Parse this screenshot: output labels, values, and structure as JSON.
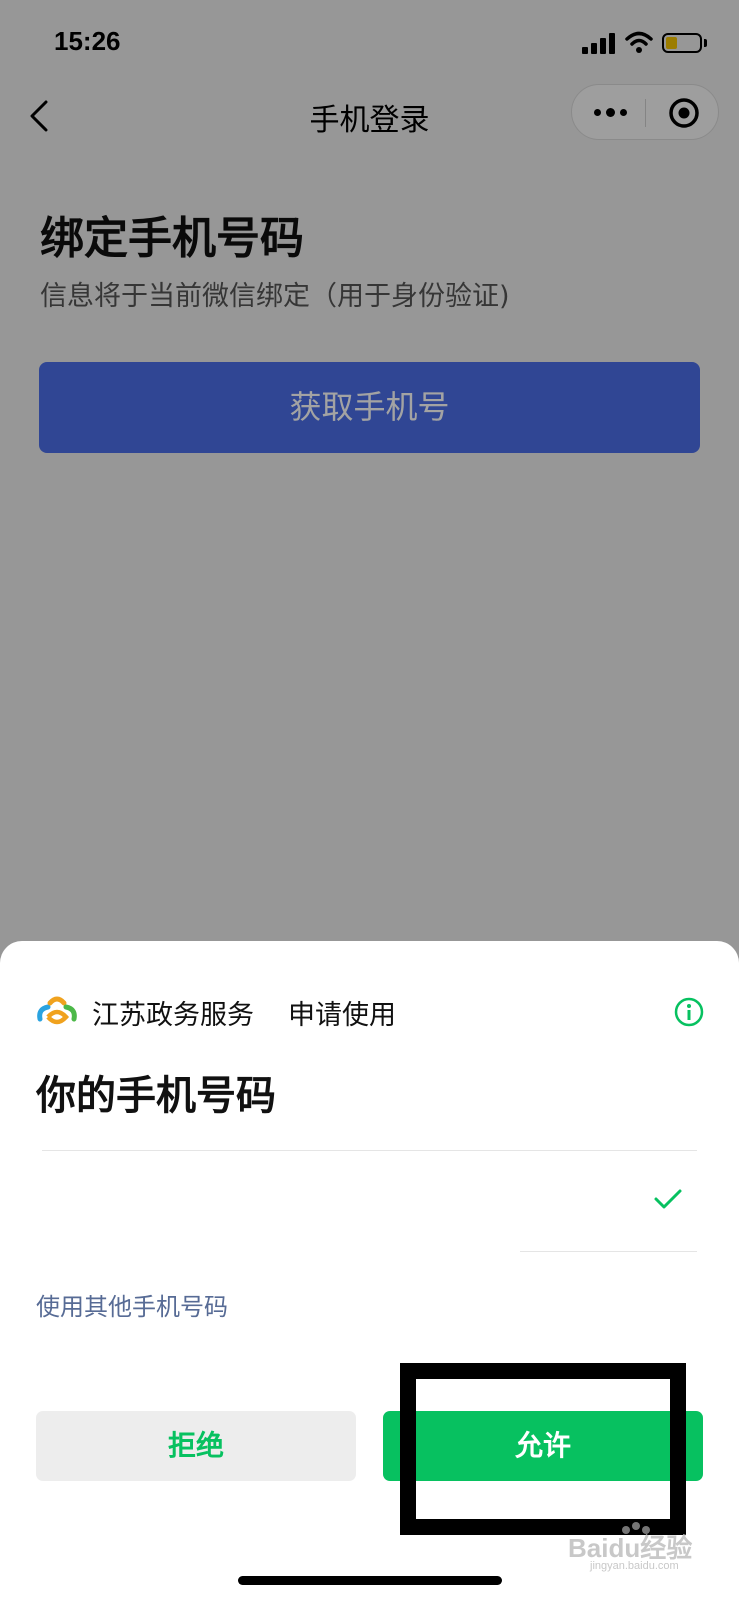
{
  "status_bar": {
    "time": "15:26"
  },
  "nav": {
    "title": "手机登录"
  },
  "page": {
    "heading": "绑定手机号码",
    "subtitle": "信息将于当前微信绑定（用于身份验证)",
    "get_phone_button": "获取手机号"
  },
  "sheet": {
    "app_name": "江苏政务服务",
    "request_text": "申请使用",
    "title": "你的手机号码",
    "phone_number": "",
    "other_phone_link": "使用其他手机号码",
    "reject_button": "拒绝",
    "allow_button": "允许"
  },
  "watermark": {
    "brand": "Baidu经验",
    "url": "jingyan.baidu.com"
  },
  "colors": {
    "wechat_green": "#07c160",
    "link_blue": "#576b95",
    "primary_blue": "#4b6ee8",
    "battery_yellow": "#f5c400"
  },
  "icons": [
    "back-icon",
    "more-icon",
    "target-icon",
    "app-logo",
    "info-icon",
    "check-icon",
    "signal-icon",
    "wifi-icon",
    "battery-icon"
  ]
}
